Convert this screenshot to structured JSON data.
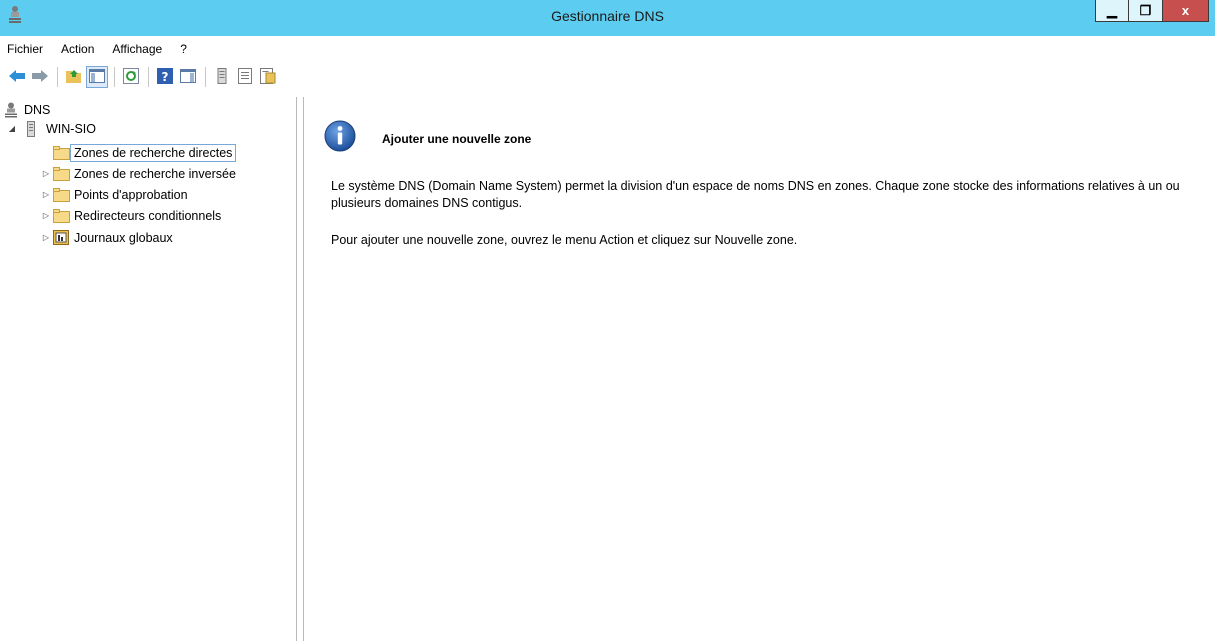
{
  "window": {
    "title": "Gestionnaire DNS",
    "buttons": {
      "minimize": "▁",
      "restore": "❐",
      "close": "x"
    }
  },
  "menu": [
    "Fichier",
    "Action",
    "Affichage",
    "?"
  ],
  "toolbar": {
    "icons": [
      "back-arrow-icon",
      "forward-arrow-icon",
      "up-folder-icon",
      "show-hide-console-tree-icon",
      "refresh-icon",
      "help-icon",
      "action-pane-icon",
      "server-icon",
      "list-icon",
      "properties-icon"
    ]
  },
  "tree": {
    "root": "DNS",
    "server": "WIN-SIO",
    "children": [
      {
        "label": "Zones de recherche directes",
        "selected": true,
        "expandable": false,
        "icon": "folder-icon"
      },
      {
        "label": "Zones de recherche inversée",
        "selected": false,
        "expandable": true,
        "icon": "folder-icon"
      },
      {
        "label": "Points d'approbation",
        "selected": false,
        "expandable": true,
        "icon": "folder-icon"
      },
      {
        "label": "Redirecteurs conditionnels",
        "selected": false,
        "expandable": true,
        "icon": "folder-icon"
      },
      {
        "label": "Journaux globaux",
        "selected": false,
        "expandable": true,
        "icon": "log-icon"
      }
    ]
  },
  "content": {
    "heading": "Ajouter une nouvelle zone",
    "paragraph1": "Le système DNS (Domain Name System) permet la division d'un espace de noms DNS en zones. Chaque zone stocke des informations relatives à un ou plusieurs domaines DNS contigus.",
    "paragraph2": "Pour ajouter une nouvelle zone, ouvrez le menu Action et cliquez sur Nouvelle zone."
  },
  "colors": {
    "titlebar": "#5ccdf0",
    "close": "#c7504f",
    "selection_border": "#7aa7d9"
  }
}
